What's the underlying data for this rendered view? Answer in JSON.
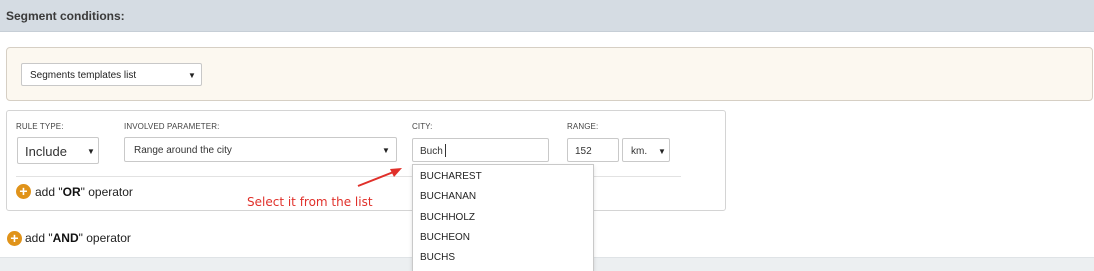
{
  "header": {
    "title": "Segment conditions:"
  },
  "templates": {
    "selected": "Segments templates list"
  },
  "rule": {
    "rule_type": {
      "label": "RULE TYPE:",
      "value": "Include"
    },
    "involved_parameter": {
      "label": "INVOLVED PARAMETER:",
      "value": "Range around the city"
    },
    "city": {
      "label": "CITY:",
      "value": "Buch"
    },
    "range": {
      "label": "RANGE:",
      "value": "152",
      "unit": "km."
    }
  },
  "or_operator": {
    "prefix": "add \"",
    "keyword": "OR",
    "suffix": "\" operator"
  },
  "and_operator": {
    "prefix": "add \"",
    "keyword": "AND",
    "suffix": "\" operator"
  },
  "city_suggestions": [
    "BUCHAREST",
    "BUCHANAN",
    "BUCHHOLZ",
    "BUCHEON",
    "BUCHS"
  ],
  "annotation": {
    "text": "Select it from the list"
  },
  "icons": {
    "add": "plus-circle-icon",
    "dropdown": "caret-down-icon",
    "annotation": "red-arrow-icon"
  },
  "colors": {
    "accent_orange": "#e0931a",
    "annotation_red": "#e0302a",
    "header_bg": "#d5dce3",
    "panel_bg": "#fcf8f0"
  }
}
